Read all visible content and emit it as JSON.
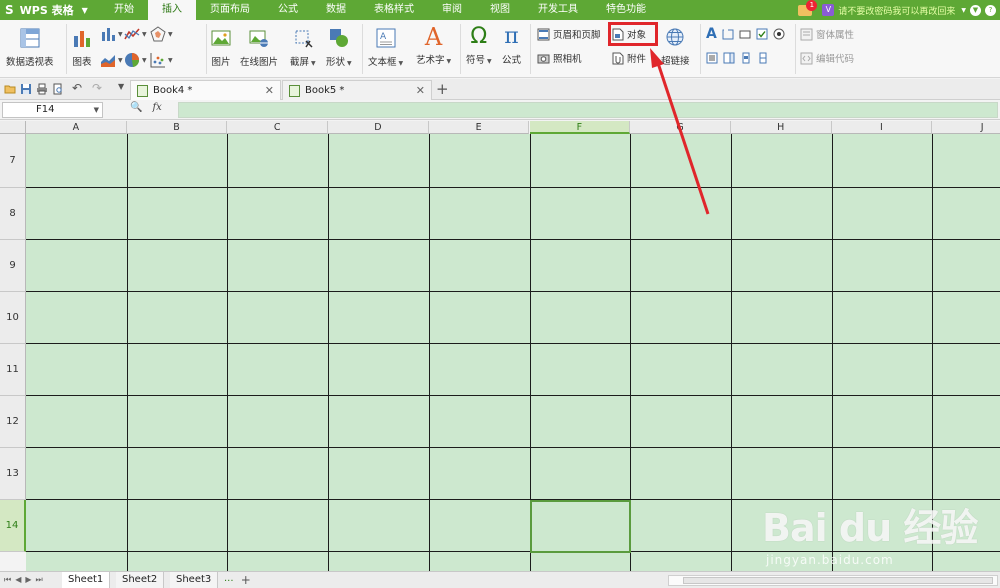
{
  "app": {
    "name": "WPS 表格",
    "logo": "S"
  },
  "menu": {
    "tabs": [
      "开始",
      "插入",
      "页面布局",
      "公式",
      "数据",
      "表格样式",
      "审阅",
      "视图",
      "开发工具",
      "特色功能"
    ],
    "active": "插入",
    "mail_badge": "1",
    "vip_label": "V",
    "promo": "请不要改密码我可以再改回来"
  },
  "ribbon": {
    "pivot": "数据透视表",
    "chart": "图表",
    "picture": "图片",
    "online_picture": "在线图片",
    "screenshot": "截屏",
    "shape": "形状",
    "textbox": "文本框",
    "wordart": "艺术字",
    "symbol": "符号",
    "formula": "公式",
    "symbol_glyph": "Ω",
    "formula_glyph": "π",
    "wordart_glyph": "A",
    "header_footer": "页眉和页脚",
    "camera": "照相机",
    "object": "对象",
    "attachment": "附件",
    "hyperlink": "超链接",
    "form_text_glyph": "A",
    "form_props": "窗体属性",
    "edit_code": "编辑代码"
  },
  "doc_tabs": [
    {
      "label": "Book4 *"
    },
    {
      "label": "Book5 *"
    }
  ],
  "formula_bar": {
    "cell_ref": "F14",
    "fx_label": "fx"
  },
  "grid": {
    "columns": [
      "A",
      "B",
      "C",
      "D",
      "E",
      "F",
      "G",
      "H",
      "I",
      "J"
    ],
    "rows": [
      "7",
      "8",
      "9",
      "10",
      "11",
      "12",
      "13",
      "14"
    ],
    "selected_column": "F",
    "selected_row": "14"
  },
  "sheets": {
    "tabs": [
      "Sheet1",
      "Sheet2",
      "Sheet3"
    ],
    "active": "Sheet1",
    "more": "···",
    "add": "+"
  },
  "watermark": {
    "brand": "Bai du 经验",
    "url": "jingyan.baidu.com"
  },
  "colors": {
    "accent": "#5ea835",
    "cell_bg": "#cde8cf",
    "highlight": "#e0262b"
  }
}
